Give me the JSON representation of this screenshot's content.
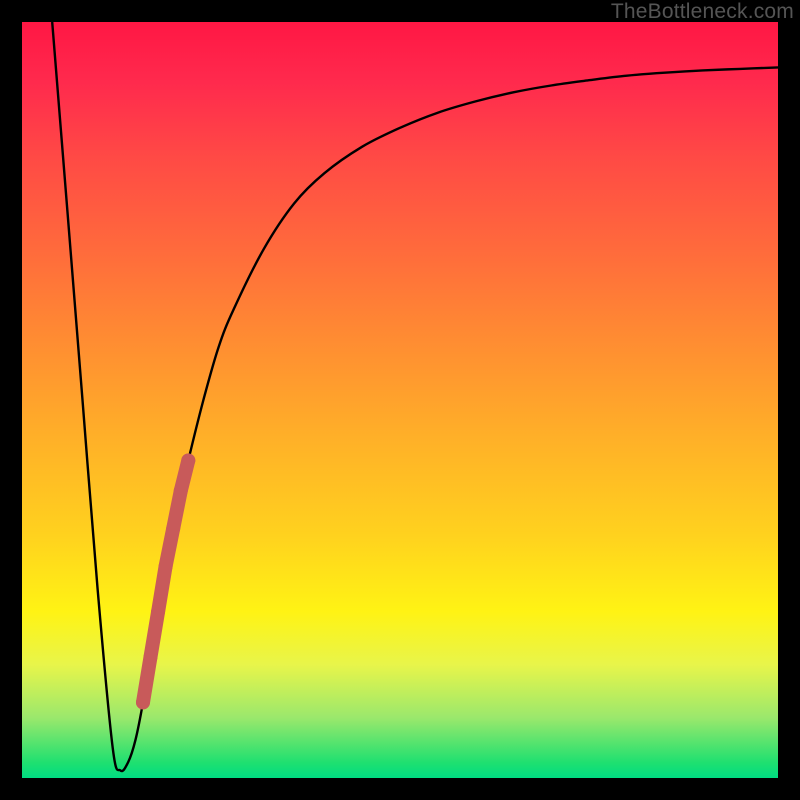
{
  "watermark": "TheBottleneck.com",
  "chart_data": {
    "type": "line",
    "title": "",
    "xlabel": "",
    "ylabel": "",
    "xlim": [
      0,
      100
    ],
    "ylim": [
      0,
      100
    ],
    "series": [
      {
        "name": "bottleneck-curve",
        "x": [
          4.0,
          6.0,
          8.0,
          10.0,
          12.0,
          13.0,
          14.0,
          15.0,
          16.0,
          18.0,
          20.0,
          22.0,
          24.0,
          26.0,
          28.0,
          32.0,
          36.0,
          40.0,
          45.0,
          50.0,
          55.0,
          60.0,
          65.0,
          70.0,
          75.0,
          80.0,
          85.0,
          90.0,
          95.0,
          100.0
        ],
        "y": [
          100.0,
          75.0,
          50.0,
          25.0,
          4.0,
          1.0,
          2.0,
          5.0,
          10.0,
          22.0,
          33.0,
          42.0,
          50.0,
          57.0,
          62.0,
          70.0,
          76.0,
          80.0,
          83.5,
          86.0,
          88.0,
          89.5,
          90.7,
          91.6,
          92.3,
          92.9,
          93.3,
          93.6,
          93.8,
          94.0
        ]
      },
      {
        "name": "highlight-segment",
        "x": [
          16.0,
          17.0,
          18.0,
          19.0,
          20.0,
          21.0,
          22.0
        ],
        "y": [
          10.0,
          16.0,
          22.0,
          28.0,
          33.0,
          38.0,
          42.0
        ]
      }
    ],
    "annotations": []
  }
}
